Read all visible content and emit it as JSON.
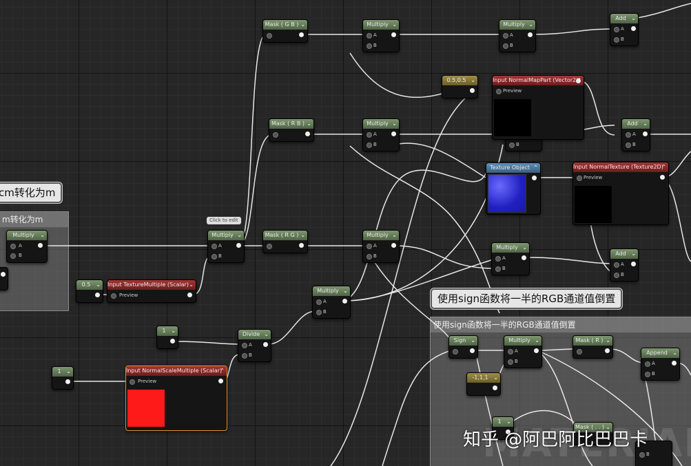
{
  "comments": {
    "left_bubble": "cm转化为m",
    "left_box_title": "m转化为m",
    "right_bubble": "使用sign函数将一半的RGB通道值倒置",
    "right_box_title": "使用sign函数将一半的RGB通道值倒置",
    "click_to_edit": "Click to edit"
  },
  "nodes": {
    "mask_gb": "Mask ( G B )",
    "mask_rb": "Mask ( R B )",
    "mask_rg": "Mask ( R G )",
    "multiply": "Multiply",
    "add": "Add",
    "divide": "Divide",
    "sign": "Sign",
    "mask_r": "Mask ( R )",
    "append": "Append",
    "texture_object": "Texture Object",
    "input_normal_map_part": "Input NormalMapPart (Vector2)",
    "input_normal_texture": "Input NormalTexture (Texture2D)",
    "input_texture_multiple": "Input TextureMultiple (Scalar)",
    "input_normal_scale_multiple": "Input NormalScaleMultiple (Scalar)",
    "preview": "Preview",
    "pin_a": "A",
    "pin_b": "B",
    "const_05": "0.5",
    "const_0505": "0.5,0.5",
    "const_1": "1",
    "const_neg111": "-1,1,1",
    "partial_mask": "Mask ( . . )"
  },
  "colors": {
    "scalar_preview": "#ff1a1a",
    "comment_bubble": "#e6e6e6"
  },
  "watermark": {
    "text": "知乎 @阿巴阿比巴巴卡",
    "material": "MATERIAL"
  }
}
